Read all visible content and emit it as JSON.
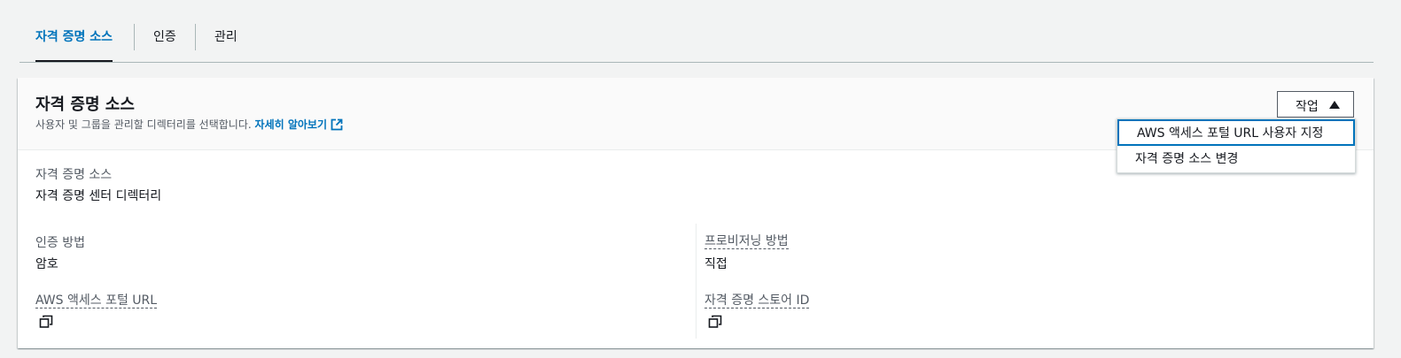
{
  "tabs": [
    {
      "label": "자격 증명 소스",
      "active": true
    },
    {
      "label": "인증",
      "active": false
    },
    {
      "label": "관리",
      "active": false
    }
  ],
  "panel": {
    "title": "자격 증명 소스",
    "description": "사용자 및 그룹을 관리할 디렉터리를 선택합니다.",
    "learn_more": "자세히 알아보기",
    "action_button": "작업",
    "dropdown_items": [
      "AWS 액세스 포털 URL 사용자 지정",
      "자격 증명 소스 변경"
    ]
  },
  "fields": {
    "identity_source_label": "자격 증명 소스",
    "identity_source_value": "자격 증명 센터 디렉터리",
    "auth_method_label": "인증 방법",
    "auth_method_value": "암호",
    "provisioning_label": "프로비저닝 방법",
    "provisioning_value": "직접",
    "portal_url_label": "AWS 액세스 포털 URL",
    "store_id_label": "자격 증명 스토어 ID"
  },
  "colors": {
    "accent": "#0073bb",
    "text": "#16191f",
    "muted": "#545b64",
    "background": "#f2f3f3"
  }
}
